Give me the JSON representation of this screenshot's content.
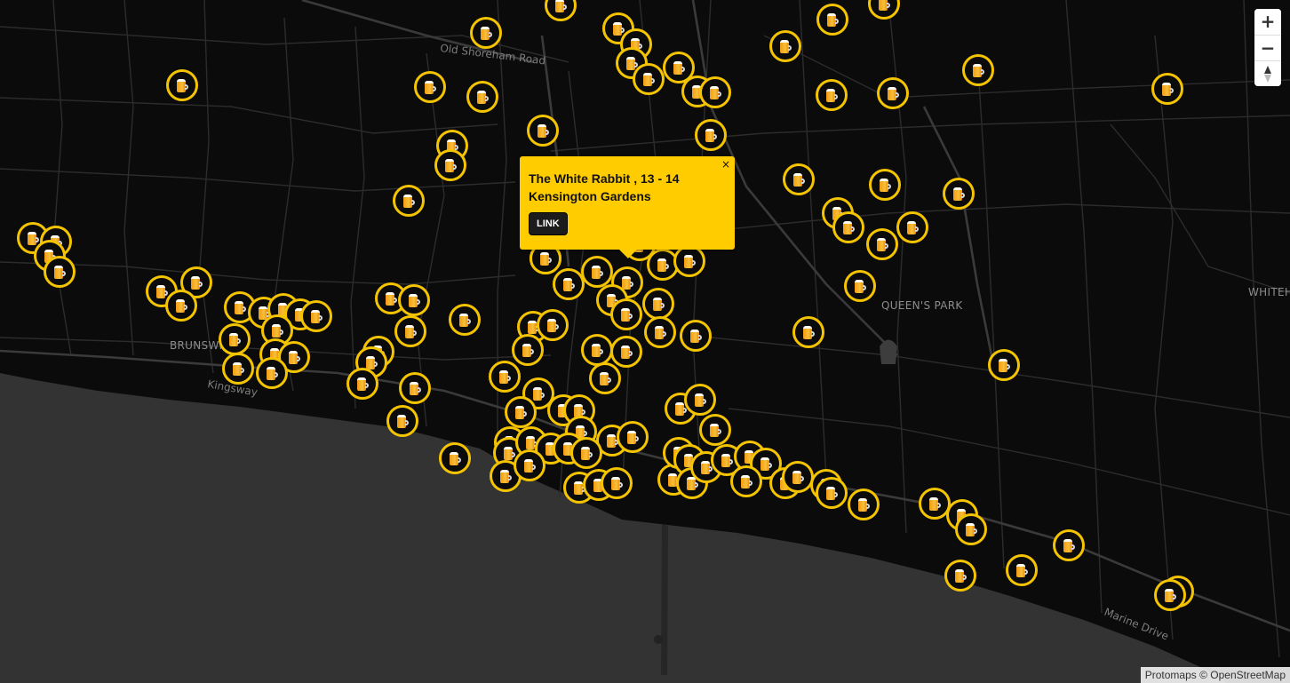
{
  "map": {
    "labels": {
      "old_shoreham_road": "Old Shoreham Road",
      "brunswick": "BRUNSWI",
      "kingsway": "Kingsway",
      "queens_park": "QUEEN'S PARK",
      "whitehawk": "WHITEH",
      "marine_drive": "Marine Drive"
    },
    "marker_icon": "beer-mug-icon",
    "colors": {
      "marker_ring": "#f5c400",
      "popup_background": "#ffcc00",
      "sea": "#333333",
      "land": "#0b0b0b"
    }
  },
  "controls": {
    "zoom_in_label": "+",
    "zoom_out_label": "−",
    "compass_icon": "compass-icon"
  },
  "popup": {
    "title": "The White Rabbit , 13 - 14 Kensington Gardens",
    "link_label": "LINK",
    "close_label": "×"
  },
  "attribution": "Protomaps © OpenStreetMap"
}
